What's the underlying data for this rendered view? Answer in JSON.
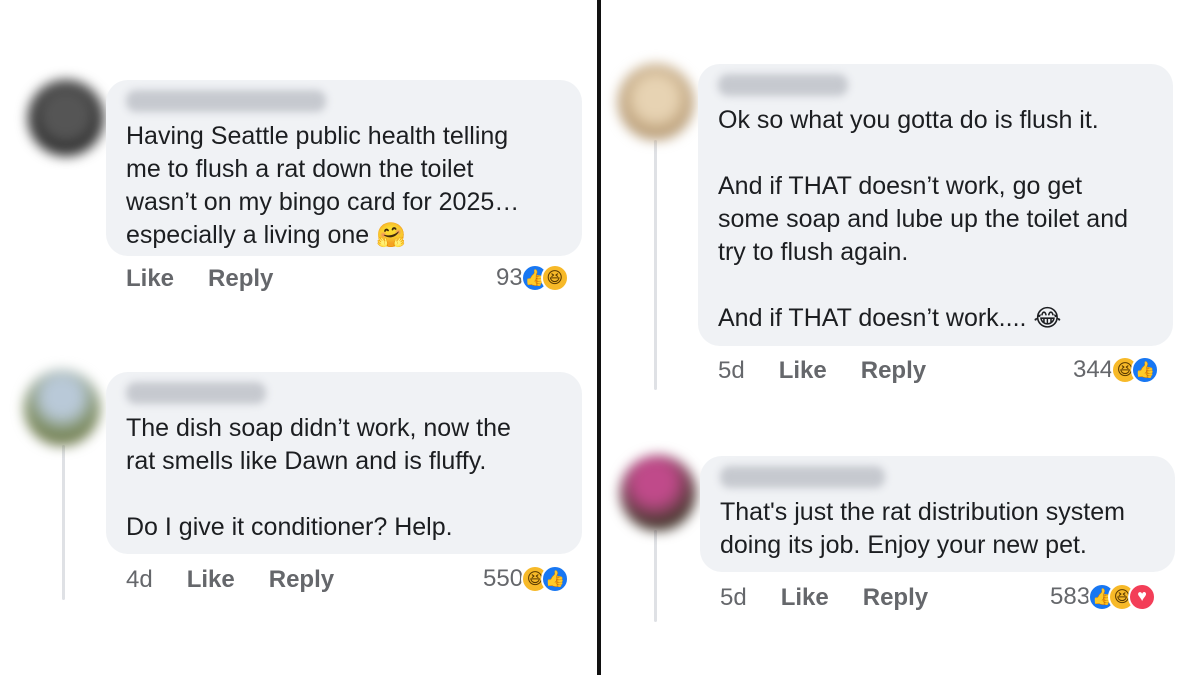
{
  "comments": [
    {
      "text": "Having Seattle public health telling\nme to flush a rat down the toilet\nwasn’t on my bingo card for 2025…\nespecially a living one",
      "emoji": "🤗",
      "age": "",
      "like": "Like",
      "reply": "Reply",
      "count": "93",
      "reactions": [
        "like-icon",
        "haha-icon"
      ]
    },
    {
      "text": "The dish soap didn’t work, now the\nrat smells like Dawn and is fluffy.\n\nDo I give it conditioner? Help.",
      "emoji": "",
      "age": "4d",
      "like": "Like",
      "reply": "Reply",
      "count": "550",
      "reactions": [
        "haha-icon",
        "like-icon"
      ]
    },
    {
      "text": "Ok so what you gotta do is flush it.\n\nAnd if THAT doesn’t work, go get\nsome soap and lube up the toilet and\ntry to flush again.\n\nAnd if THAT doesn’t work....",
      "emoji": "😂",
      "age": "5d",
      "like": "Like",
      "reply": "Reply",
      "count": "344",
      "reactions": [
        "haha-icon",
        "like-icon"
      ]
    },
    {
      "text": "That's just the rat distribution system\ndoing its job.  Enjoy your new pet.",
      "emoji": "",
      "age": "5d",
      "like": "Like",
      "reply": "Reply",
      "count": "583",
      "reactions": [
        "like-icon",
        "haha-icon",
        "love-icon"
      ]
    }
  ],
  "colors": {
    "bubble": "#f0f2f5",
    "meta_text": "#65676b",
    "like_blue": "#1877f2",
    "haha_yellow": "#f7b928",
    "love_red": "#f33e58"
  }
}
